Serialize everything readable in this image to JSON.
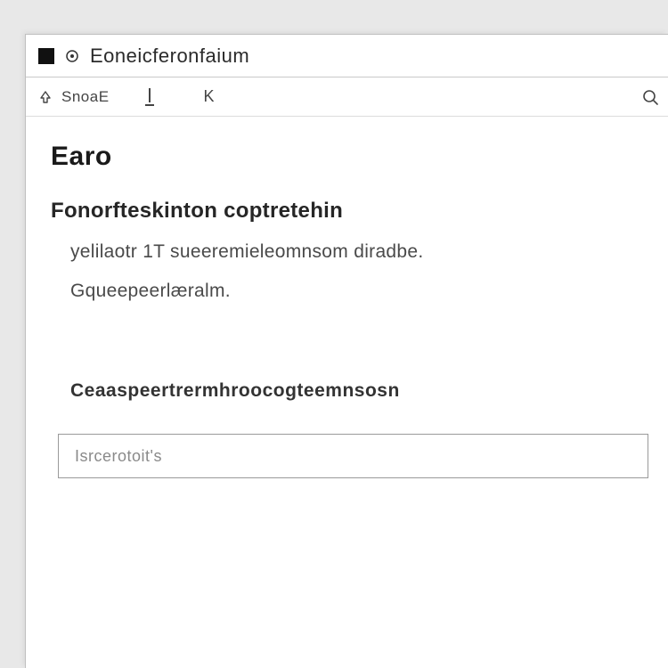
{
  "window": {
    "title": "Eoneicferonfaium"
  },
  "toolbar": {
    "label": "SnoaE",
    "glyph_c": "K"
  },
  "content": {
    "page_title": "Earo",
    "subheading": "Fonorfteskinton coptretehin",
    "line1": "yelilaotr 1T sueeremieleomnsom diradbe.",
    "line2": "Gqueepeerlæralm.",
    "section_label": "Ceaaspeertrermhroocogteemnsosn"
  },
  "input": {
    "placeholder": "Isrcerotoit's"
  }
}
